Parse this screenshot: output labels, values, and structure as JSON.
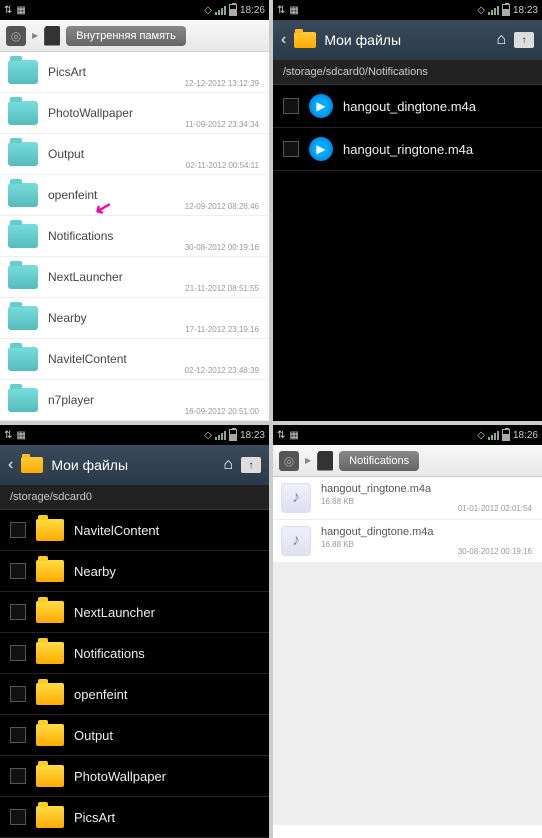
{
  "pane1": {
    "status": {
      "time": "18:26"
    },
    "breadcrumb": "Внутренняя память",
    "rows": [
      {
        "name": "PicsArt",
        "dir": "<DIR>",
        "ts": "12-12-2012 13:12:39"
      },
      {
        "name": "PhotoWallpaper",
        "dir": "<DIR>",
        "ts": "11-09-2012 23:34:34"
      },
      {
        "name": "Output",
        "dir": "<DIR>",
        "ts": "02-11-2012 00:54:11"
      },
      {
        "name": "openfeint",
        "dir": "<DIR>",
        "ts": "12-09-2012 08:26:46"
      },
      {
        "name": "Notifications",
        "dir": "<DIR>",
        "ts": "30-08-2012 00:19:16"
      },
      {
        "name": "NextLauncher",
        "dir": "<DIR>",
        "ts": "21-11-2012 08:51:55"
      },
      {
        "name": "Nearby",
        "dir": "<DIR>",
        "ts": "17-11-2012 23:19:16"
      },
      {
        "name": "NavitelContent",
        "dir": "<DIR>",
        "ts": "02-12-2012 23:48:39"
      },
      {
        "name": "n7player",
        "dir": "<DIR>",
        "ts": "16-09-2012 20:51:00"
      }
    ]
  },
  "pane2": {
    "status": {
      "time": "18:23"
    },
    "title": "Мои файлы",
    "path": "/storage/sdcard0/Notifications",
    "rows": [
      {
        "name": "hangout_dingtone.m4a"
      },
      {
        "name": "hangout_ringtone.m4a"
      }
    ]
  },
  "pane3": {
    "status": {
      "time": "18:23"
    },
    "title": "Мои файлы",
    "path": "/storage/sdcard0",
    "rows": [
      {
        "name": "NavitelContent"
      },
      {
        "name": "Nearby"
      },
      {
        "name": "NextLauncher"
      },
      {
        "name": "Notifications"
      },
      {
        "name": "openfeint"
      },
      {
        "name": "Output"
      },
      {
        "name": "PhotoWallpaper"
      },
      {
        "name": "PicsArt"
      }
    ]
  },
  "pane4": {
    "status": {
      "time": "18:26"
    },
    "breadcrumb": "Notifications",
    "rows": [
      {
        "name": "hangout_ringtone.m4a",
        "size": "16.88 KB",
        "ts": "01-01-2012 02:01:54"
      },
      {
        "name": "hangout_dingtone.m4a",
        "size": "16.88 KB",
        "ts": "30-08-2012 00:19:16"
      }
    ]
  }
}
